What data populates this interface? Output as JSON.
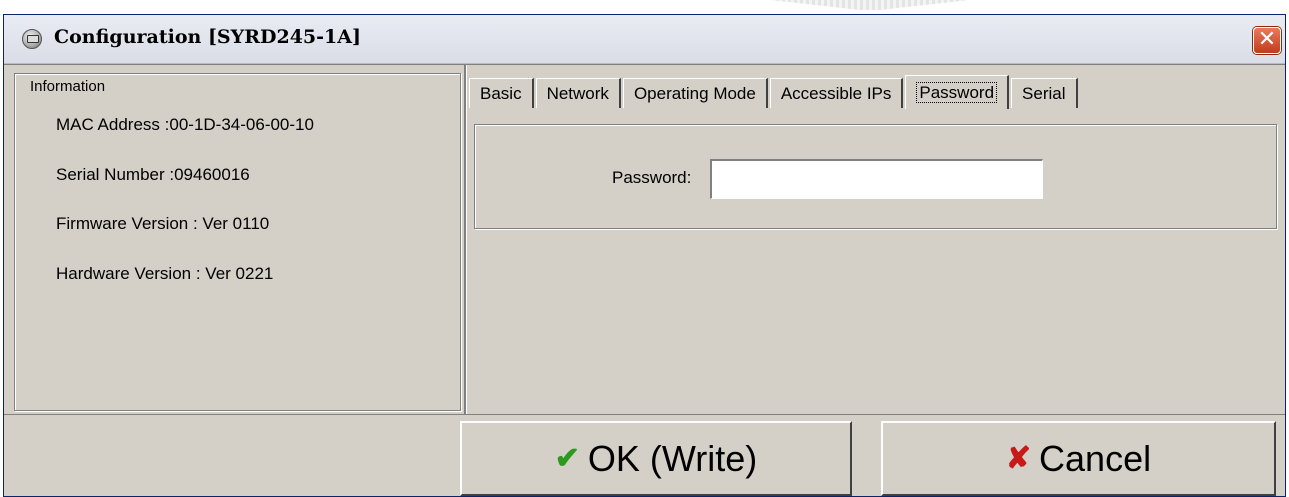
{
  "window": {
    "title": "Configuration [SYRD245-1A]",
    "close_symbol": "✕"
  },
  "information": {
    "legend": "Information",
    "lines": [
      "MAC Address :00-1D-34-06-00-10",
      "Serial Number :09460016",
      "Firmware Version : Ver 0110",
      "Hardware Version : Ver 0221"
    ]
  },
  "tabs": [
    {
      "label": "Basic",
      "active": false
    },
    {
      "label": "Network",
      "active": false
    },
    {
      "label": "Operating Mode",
      "active": false
    },
    {
      "label": "Accessible IPs",
      "active": false
    },
    {
      "label": "Password",
      "active": true
    },
    {
      "label": "Serial",
      "active": false
    }
  ],
  "password_panel": {
    "label": "Password:",
    "value": ""
  },
  "buttons": {
    "ok_icon": "✔",
    "ok_label": "OK (Write)",
    "cancel_icon": "✘",
    "cancel_label": "Cancel"
  },
  "icons": {
    "app": "device-icon",
    "close": "close-icon",
    "ok": "checkmark-icon",
    "cancel": "x-mark-icon"
  },
  "colors": {
    "dialog_face": "#d4d0c8",
    "close_button": "#c23c1c",
    "ok_check": "#2c9a1e",
    "cancel_x": "#c81818"
  }
}
